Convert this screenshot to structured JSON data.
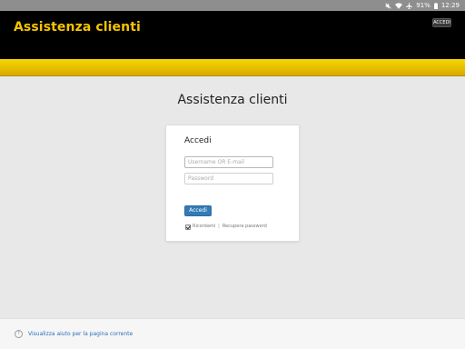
{
  "status_bar": {
    "battery": "91%",
    "time": "12:29",
    "icons": [
      "mute-icon",
      "wifi-icon",
      "airplane-icon",
      "battery-icon"
    ]
  },
  "header": {
    "title": "Assistenza clienti",
    "login_button": "ACCEDI"
  },
  "colors": {
    "header_bg": "#000000",
    "brand_yellow": "#f5c400",
    "primary_button": "#337ab7",
    "link": "#2a6ebb"
  },
  "main": {
    "title": "Assistenza clienti"
  },
  "login": {
    "heading": "Accedi",
    "username_placeholder": "Username OR E-mail",
    "password_placeholder": "Password",
    "submit": "Accedi",
    "remember": "Ricordami",
    "separator": "|",
    "recover": "Recupera password",
    "remember_checked": true
  },
  "footer": {
    "help_icon": "?",
    "help_link": "Visualizza aiuto per la pagina corrente"
  }
}
